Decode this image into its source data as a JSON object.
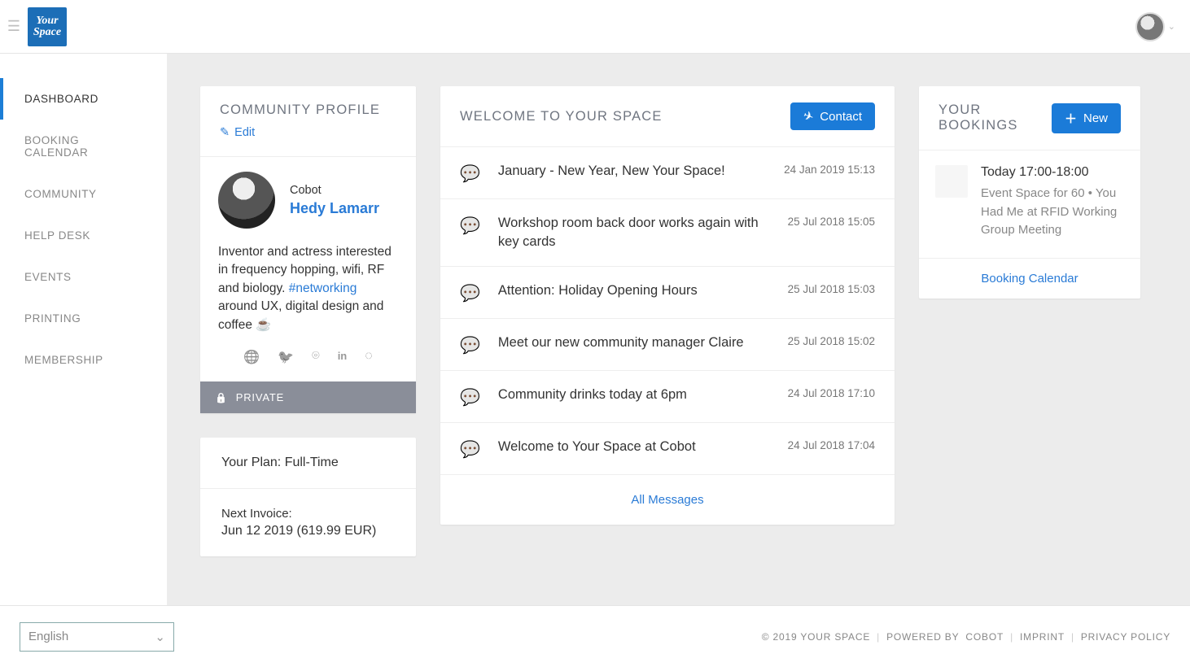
{
  "brand": "Your Space",
  "header": {
    "logo_line1": "Your",
    "logo_line2": "Space"
  },
  "sidebar": {
    "items": [
      {
        "label": "DASHBOARD",
        "active": true
      },
      {
        "label": "BOOKING CALENDAR",
        "active": false
      },
      {
        "label": "COMMUNITY",
        "active": false
      },
      {
        "label": "HELP DESK",
        "active": false
      },
      {
        "label": "EVENTS",
        "active": false
      },
      {
        "label": "PRINTING",
        "active": false
      },
      {
        "label": "MEMBERSHIP",
        "active": false
      }
    ]
  },
  "profile": {
    "title": "COMMUNITY PROFILE",
    "edit_label": "Edit",
    "org": "Cobot",
    "name": "Hedy Lamarr",
    "bio_pre": "Inventor and actress interested in frequency hopping, wifi, RF and biology. ",
    "bio_hashtag": "#networking",
    "bio_post": " around UX, digital design and coffee ",
    "private_label": "PRIVATE"
  },
  "plan": {
    "your_plan_label": "Your Plan:",
    "your_plan_value": "Full-Time",
    "next_invoice_label": "Next Invoice:",
    "next_invoice_value": "Jun 12 2019 (619.99 EUR)"
  },
  "welcome": {
    "title": "WELCOME TO YOUR SPACE",
    "contact_label": "Contact",
    "all_messages_label": "All Messages",
    "messages": [
      {
        "title": "January - New Year, New Your Space!",
        "date": "24 Jan 2019 15:13"
      },
      {
        "title": "Workshop room back door works again with key cards",
        "date": "25 Jul 2018 15:05"
      },
      {
        "title": "Attention: Holiday Opening Hours",
        "date": "25 Jul 2018 15:03"
      },
      {
        "title": "Meet our new community manager Claire",
        "date": "25 Jul 2018 15:02"
      },
      {
        "title": "Community drinks today at 6pm",
        "date": "24 Jul 2018 17:10"
      },
      {
        "title": "Welcome to Your Space at Cobot",
        "date": "24 Jul 2018 17:04"
      }
    ]
  },
  "bookings": {
    "title": "YOUR BOOKINGS",
    "new_label": "New",
    "item": {
      "time": "Today 17:00-18:00",
      "desc": "Event Space for 60 • You Had Me at RFID Working Group Meeting"
    },
    "calendar_link": "Booking Calendar"
  },
  "footer": {
    "language": "English",
    "copyright": "© 2019 YOUR SPACE",
    "powered_pre": "POWERED BY ",
    "powered_link": "COBOT",
    "imprint": "IMPRINT",
    "privacy": "PRIVACY POLICY"
  }
}
